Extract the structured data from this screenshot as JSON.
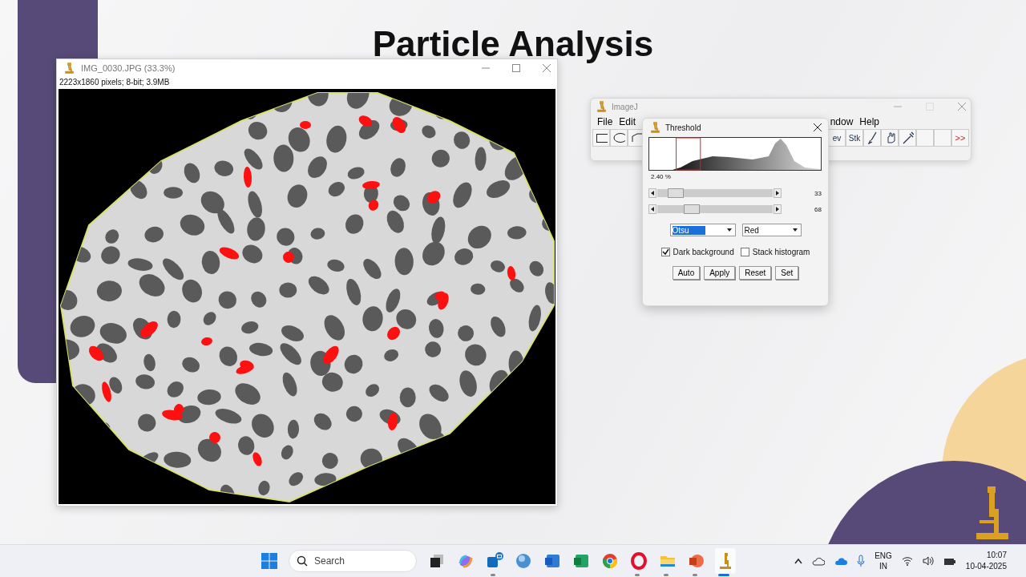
{
  "slide": {
    "title": "Particle Analysis"
  },
  "image_window": {
    "title": "IMG_0030.JPG (33.3%)",
    "info": "2223x1860 pixels; 8-bit; 3.9MB"
  },
  "imagej_window": {
    "title": "ImageJ",
    "menu_left": [
      "File",
      "Edit"
    ],
    "menu_right": [
      "ndow",
      "Help"
    ],
    "toolbar_left": [
      {
        "kind": "rect"
      },
      {
        "kind": "oval"
      },
      {
        "kind": "poly"
      }
    ],
    "toolbar_right": [
      {
        "kind": "text",
        "label": "ev"
      },
      {
        "kind": "text",
        "label": "Stk"
      },
      {
        "kind": "brush"
      },
      {
        "kind": "hand"
      },
      {
        "kind": "dropper"
      },
      {
        "kind": "blank"
      },
      {
        "kind": "blank"
      },
      {
        "kind": "more",
        "label": ">>"
      }
    ]
  },
  "threshold": {
    "title": "Threshold",
    "percent": "2.40 %",
    "sliders": [
      {
        "level": 0.16,
        "reading": "33"
      },
      {
        "level": 0.3,
        "reading": "68"
      }
    ],
    "method": {
      "value": "Otsu",
      "focused": true
    },
    "display": {
      "value": "Red",
      "focused": false
    },
    "checkboxes": [
      {
        "label": "Dark background",
        "checked": true
      },
      {
        "label": "Stack histogram",
        "checked": false
      }
    ],
    "buttons": [
      "Auto",
      "Apply",
      "Reset",
      "Set"
    ]
  },
  "taskbar": {
    "search_placeholder": "Search",
    "apps": [
      {
        "kind": "taskview",
        "running": false,
        "selected": false
      },
      {
        "kind": "copilot",
        "running": false,
        "selected": false
      },
      {
        "kind": "outlook",
        "running": true,
        "selected": false
      },
      {
        "kind": "globe",
        "running": false,
        "selected": false
      },
      {
        "kind": "word",
        "running": false,
        "selected": false
      },
      {
        "kind": "excel",
        "running": false,
        "selected": false
      },
      {
        "kind": "chrome",
        "running": false,
        "selected": false
      },
      {
        "kind": "opera",
        "running": true,
        "selected": false
      },
      {
        "kind": "folder",
        "running": true,
        "selected": false
      },
      {
        "kind": "powerpoint",
        "running": true,
        "selected": false
      },
      {
        "kind": "microscope",
        "running": true,
        "selected": true
      }
    ],
    "language": "ENG",
    "region": "IN",
    "time": "10:07",
    "date": "10-04-2025"
  }
}
